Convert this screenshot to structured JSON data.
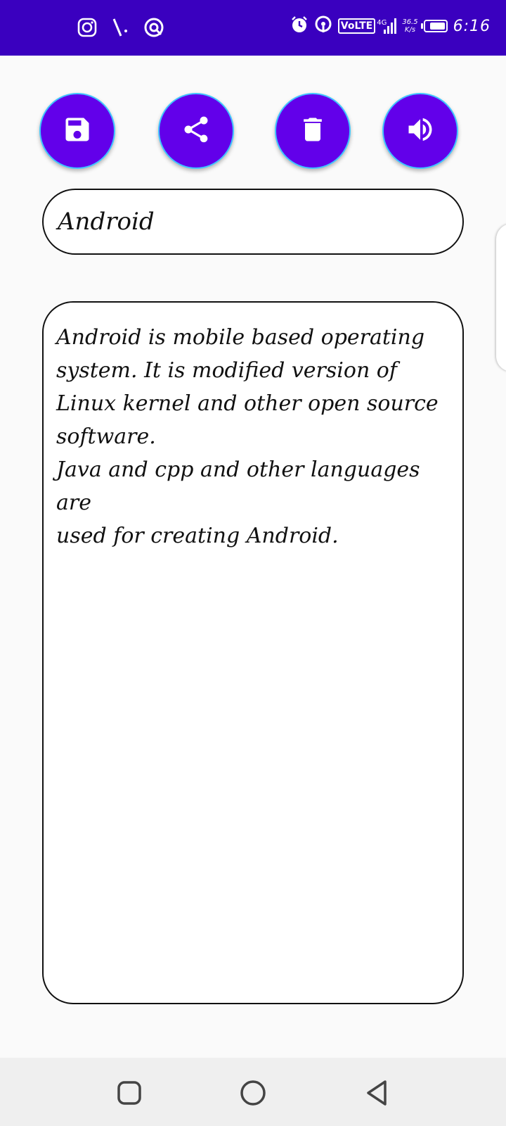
{
  "status_bar": {
    "time": "6:16",
    "network_type": "VoLTE",
    "network_gen": "4G",
    "speed_value": "36.5",
    "speed_unit": "K/s",
    "battery_level": 0.8,
    "left_icons": [
      "instagram-icon",
      "signal-slash-icon",
      "vpn-icon"
    ],
    "right_icons": [
      "alarm-icon",
      "hotspot-icon",
      "signal-bars-icon",
      "battery-icon"
    ]
  },
  "toolbar": {
    "buttons": [
      {
        "name": "save-button",
        "icon": "save-icon"
      },
      {
        "name": "share-button",
        "icon": "share-icon"
      },
      {
        "name": "delete-button",
        "icon": "trash-icon"
      },
      {
        "name": "speak-button",
        "icon": "volume-icon"
      }
    ],
    "button_color": "#6200ea",
    "button_border_color": "#40c4ff"
  },
  "note": {
    "title": "Android",
    "body": "Android is mobile based operating\nsystem. It is modified version of\nLinux kernel and other open source\nsoftware.\nJava and cpp and other languages are\nused for creating Android."
  },
  "nav_bar": {
    "buttons": [
      "recent-apps-icon",
      "home-icon",
      "back-icon"
    ]
  },
  "colors": {
    "status_bar": "#3a00bf",
    "accent": "#6200ea",
    "background": "#fafafa"
  }
}
